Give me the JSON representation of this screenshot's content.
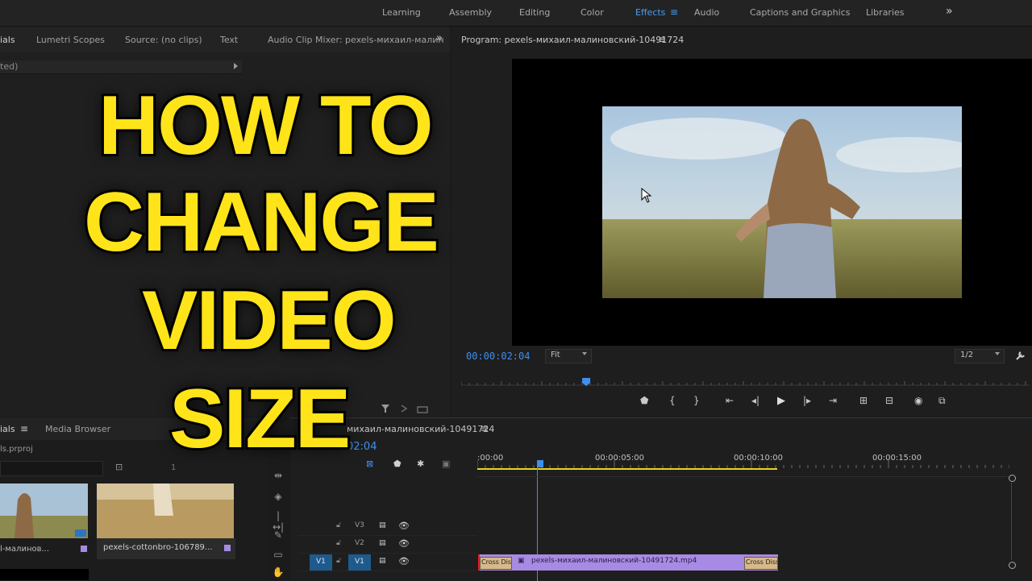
{
  "workspaces": {
    "items": [
      "Learning",
      "Assembly",
      "Editing",
      "Color",
      "Effects",
      "Audio",
      "Captions and Graphics",
      "Libraries"
    ],
    "active": "Effects",
    "more_label": "»"
  },
  "source_panel": {
    "tabs": [
      "ials",
      "Lumetri Scopes",
      "Source: (no clips)",
      "Text",
      "Audio Clip Mixer: pexels-михаил-малин"
    ],
    "more_label": "»",
    "sub_text": "ted)"
  },
  "program_panel": {
    "title": "Program: pexels-михаил-малиновский-10491724",
    "menu_label": "≡",
    "timecode": "00:00:02:04",
    "fit_label": "Fit",
    "resolution_label": "1/2",
    "playhead_fraction": 0.22
  },
  "project_panel": {
    "tabs": [
      "ials",
      "Media Browser"
    ],
    "project_file": "ls.prproj",
    "items_count_partial": "1",
    "thumbs": [
      {
        "label": "l-малинов..."
      },
      {
        "label": "pexels-cottonbro-106789..."
      }
    ]
  },
  "timeline": {
    "title": "михаил-малиновский-10491724",
    "menu_label": "≡",
    "timecode": "02:04",
    "ruler_ticks": [
      ":00:00",
      "00:00:05:00",
      "00:00:10:00",
      "00:00:15:00"
    ],
    "tracks": [
      {
        "label": "V3"
      },
      {
        "label": "V2"
      },
      {
        "label": "V1",
        "source": "V1"
      }
    ],
    "clip": {
      "name": "pexels-михаил-малиновский-10491724.mp4",
      "transition_in": "Cross Diss",
      "transition_out": "Cross Diss"
    }
  },
  "overlay_title": {
    "lines": [
      "HOW TO",
      "CHANGE",
      "VIDEO",
      "SIZE"
    ]
  },
  "colors": {
    "accent": "#3f8ef0",
    "clip": "#a78ae3",
    "title": "#ffe41a",
    "workarea": "#e8d21a"
  }
}
